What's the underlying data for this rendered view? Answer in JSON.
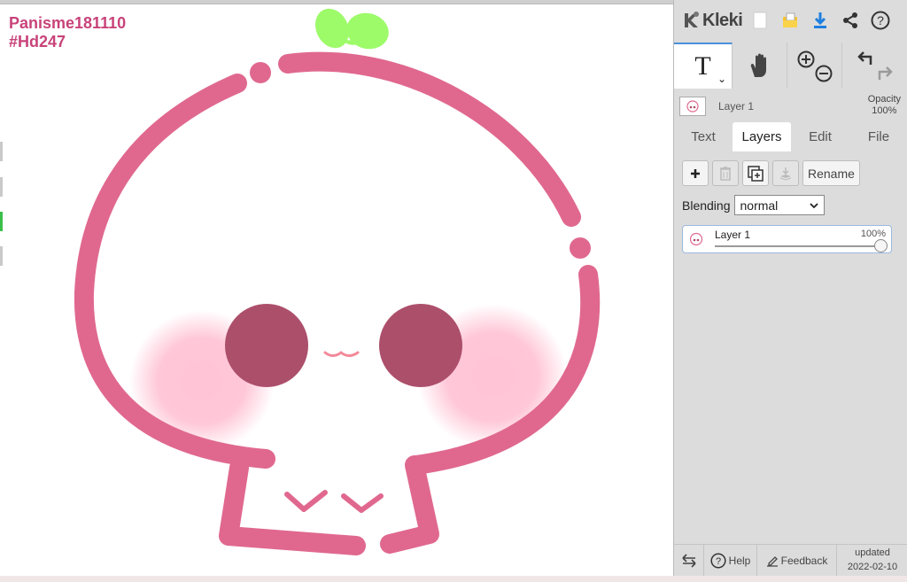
{
  "canvas": {
    "watermark_line1": "Panisme181110",
    "watermark_line2": "#Hd247",
    "colors": {
      "stroke": "#e0688f",
      "leaf": "#9dfb6a",
      "eye": "#ac4f6b",
      "blush": "#ffc4d6",
      "watermark": "#c8437a"
    }
  },
  "app": {
    "logo_text": "Kleki",
    "toolbar_icons": [
      "new-image-icon",
      "import-folder-icon",
      "download-icon",
      "share-icon",
      "help-icon"
    ]
  },
  "tools": {
    "active": "text",
    "text_glyph": "T",
    "caret": "⌄",
    "items": [
      "text-tool",
      "hand-tool",
      "zoom-tool",
      "undo-redo"
    ]
  },
  "layer_info": {
    "name": "Layer 1",
    "opacity_label": "Opacity",
    "opacity_value": "100%"
  },
  "tabs": [
    {
      "label": "Text",
      "active": false
    },
    {
      "label": "Layers",
      "active": true
    },
    {
      "label": "Edit",
      "active": false
    },
    {
      "label": "File",
      "active": false
    }
  ],
  "layers_panel": {
    "rename_label": "Rename",
    "blending_label": "Blending",
    "blending_value": "normal",
    "layers": [
      {
        "name": "Layer 1",
        "opacity": "100%",
        "opacity_fraction": 1.0
      }
    ]
  },
  "footer": {
    "help_label": "Help",
    "feedback_label": "Feedback",
    "updated_label": "updated",
    "updated_date": "2022-02-10"
  }
}
